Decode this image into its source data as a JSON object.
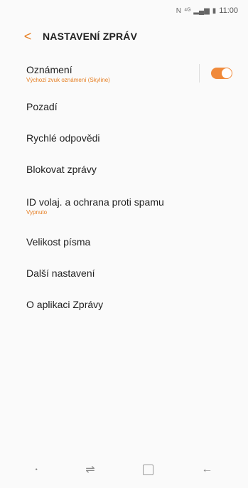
{
  "status": {
    "time": "11:00",
    "icons": [
      "nfc-icon",
      "lte-icon",
      "signal-icon",
      "battery-icon"
    ]
  },
  "header": {
    "title": "NASTAVENÍ ZPRÁV"
  },
  "settings": [
    {
      "label": "Oznámení",
      "sub": "Výchozí zvuk oznámení (Skyline)",
      "toggle": true
    },
    {
      "label": "Pozadí"
    },
    {
      "label": "Rychlé odpovědi"
    },
    {
      "label": "Blokovat zprávy"
    },
    {
      "label": "ID volaj. a ochrana proti spamu",
      "sub": "Vypnuto"
    },
    {
      "label": "Velikost písma"
    },
    {
      "label": "Další nastavení"
    },
    {
      "label": "O aplikaci Zprávy"
    }
  ],
  "colors": {
    "accent": "#e67e22",
    "toggle_on": "#f08a3b"
  },
  "navbar": [
    "dot-icon",
    "recents-icon",
    "home-icon",
    "back-icon"
  ]
}
